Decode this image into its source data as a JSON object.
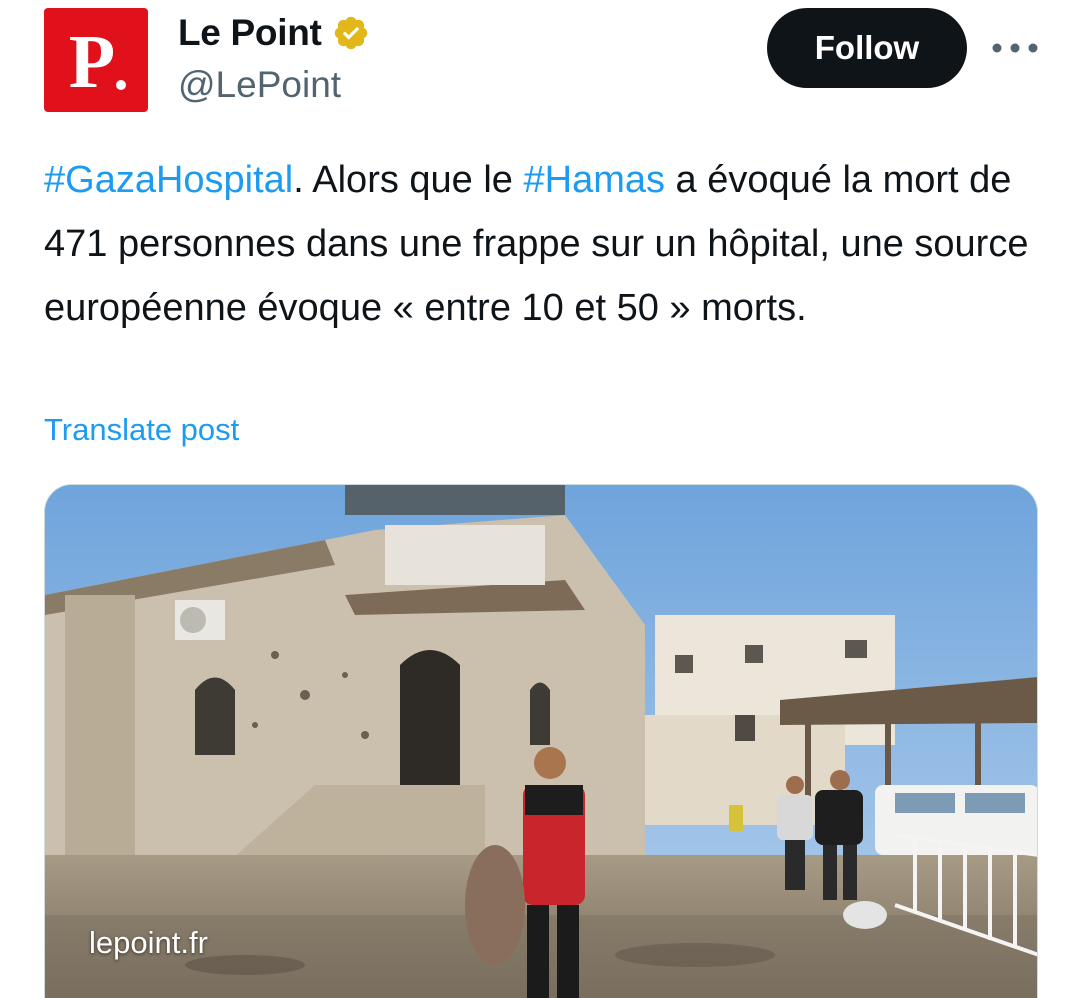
{
  "author": {
    "display_name": "Le Point",
    "handle": "@LePoint",
    "avatar_letter": "P",
    "avatar_color": "#e0111b",
    "verified_icon": "gold-verified-badge"
  },
  "actions": {
    "follow_label": "Follow",
    "more_icon": "more-horizontal-icon"
  },
  "post": {
    "hashtag_1": "#GazaHospital",
    "text_1": ". Alors que le ",
    "hashtag_2": "#Hamas",
    "text_2": " a évoqué la mort de 471 personnes dans une frappe sur un hôpital, une source européenne évoque « entre 10 et 50 » morts.",
    "translate_label": "Translate post"
  },
  "media": {
    "watermark": "lepoint.fr"
  },
  "colors": {
    "link": "#1d9bf0",
    "text": "#0f1419",
    "secondary": "#536471",
    "follow_bg": "#0f1419"
  }
}
